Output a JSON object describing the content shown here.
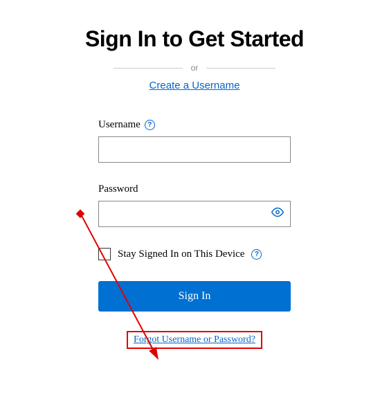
{
  "title": "Sign In to Get Started",
  "divider_text": "or",
  "create_link": "Create a Username",
  "username": {
    "label": "Username"
  },
  "password": {
    "label": "Password"
  },
  "stay_signed": {
    "label": "Stay Signed In on This Device"
  },
  "signin_button": "Sign In",
  "forgot_link": "Forgot Username or Password?"
}
